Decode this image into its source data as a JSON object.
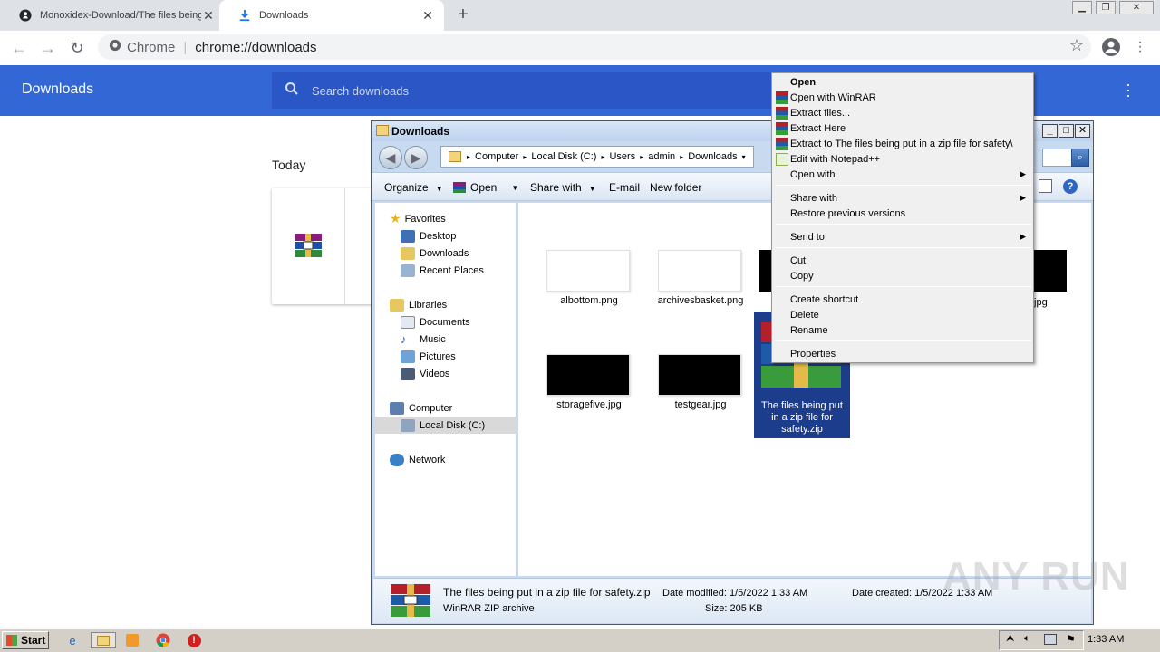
{
  "browser": {
    "tabs": [
      {
        "label": "Monoxidex-Download/The files being put in a zip file for safety",
        "icon": "github-icon"
      },
      {
        "label": "Downloads",
        "icon": "download-icon"
      }
    ],
    "omnibox": {
      "scheme_label": "Chrome",
      "url": "chrome://downloads"
    }
  },
  "downloads_page": {
    "title": "Downloads",
    "search_placeholder": "Search downloads",
    "section": "Today"
  },
  "explorer": {
    "title": "Downloads",
    "breadcrumbs": [
      "Computer",
      "Local Disk (C:)",
      "Users",
      "admin",
      "Downloads"
    ],
    "commands": {
      "organize": "Organize",
      "open": "Open",
      "share": "Share with",
      "email": "E-mail",
      "newfolder": "New folder"
    },
    "nav": {
      "favorites": "Favorites",
      "desktop": "Desktop",
      "downloads": "Downloads",
      "recent": "Recent Places",
      "libraries": "Libraries",
      "documents": "Documents",
      "music": "Music",
      "pictures": "Pictures",
      "videos": "Videos",
      "computer": "Computer",
      "localdisk": "Local Disk (C:)",
      "network": "Network"
    },
    "files": [
      {
        "name": "albottom.png"
      },
      {
        "name": "archivesbasket.png"
      },
      {
        "name": ".jpg"
      },
      {
        "name": "storagefive.jpg"
      },
      {
        "name": "testgear.jpg"
      },
      {
        "name_line1": "The files being put",
        "name_line2": "in a zip file for",
        "name_line3": "safety.zip"
      }
    ],
    "details": {
      "filename": "The files being put in a zip file for safety.zip",
      "type": "WinRAR ZIP archive",
      "modified": "Date modified: 1/5/2022 1:33 AM",
      "created": "Date created: 1/5/2022 1:33 AM",
      "size": "Size: 205 KB"
    }
  },
  "context_menu": {
    "open": "Open",
    "open_winrar": "Open with WinRAR",
    "extract_files": "Extract files...",
    "extract_here": "Extract Here",
    "extract_to": "Extract to The files being put in a zip file for safety\\",
    "edit_notepad": "Edit with Notepad++",
    "open_with": "Open with",
    "share_with": "Share with",
    "restore": "Restore previous versions",
    "send_to": "Send to",
    "cut": "Cut",
    "copy": "Copy",
    "create_shortcut": "Create shortcut",
    "delete": "Delete",
    "rename": "Rename",
    "properties": "Properties"
  },
  "taskbar": {
    "start": "Start",
    "clock": "1:33 AM"
  },
  "watermark": "ANY RUN",
  "colors": {
    "chrome_header": "#3367d6",
    "selection": "#1c3c8c",
    "winrar_red": "#b8241c"
  }
}
